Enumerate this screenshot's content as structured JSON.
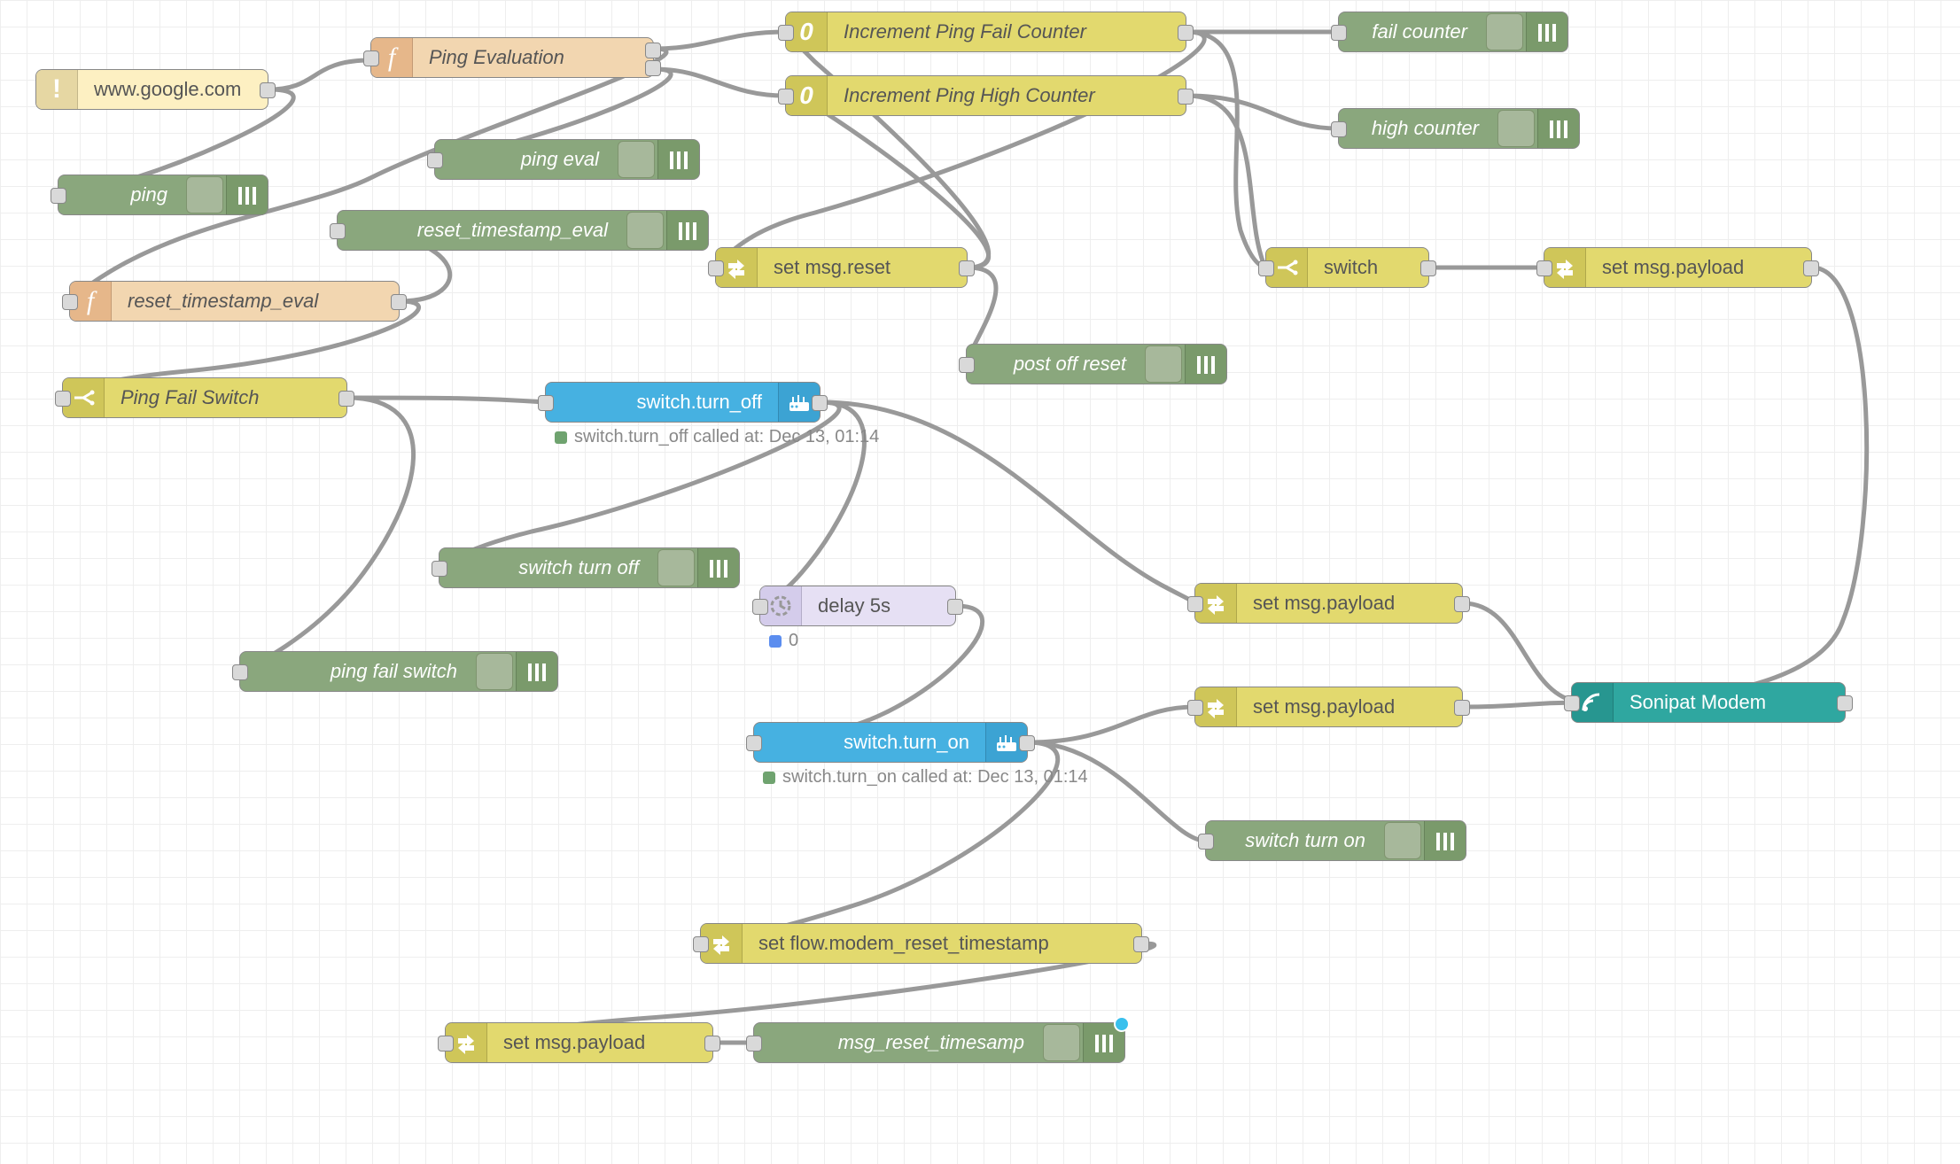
{
  "nodes": {
    "www_google": {
      "label": "www.google.com"
    },
    "ping_eval_fn": {
      "label": "Ping Evaluation"
    },
    "inc_fail": {
      "label": "Increment Ping Fail Counter"
    },
    "inc_high": {
      "label": "Increment Ping High Counter"
    },
    "fail_counter": {
      "label": "fail counter"
    },
    "high_counter": {
      "label": "high counter"
    },
    "ping_debug": {
      "label": "ping"
    },
    "ping_eval_debug": {
      "label": "ping eval"
    },
    "reset_ts_debug": {
      "label": "reset_timestamp_eval"
    },
    "reset_ts_fn": {
      "label": "reset_timestamp_eval"
    },
    "set_reset": {
      "label": "set msg.reset"
    },
    "post_off_reset": {
      "label": "post off reset"
    },
    "switch_gen": {
      "label": "switch"
    },
    "set_payload_1": {
      "label": "set msg.payload"
    },
    "ping_fail_sw": {
      "label": "Ping Fail Switch"
    },
    "switch_off": {
      "label": "switch.turn_off"
    },
    "switch_off_dbg": {
      "label": "switch turn off"
    },
    "ping_fail_dbg": {
      "label": "ping fail switch"
    },
    "delay5": {
      "label": "delay 5s"
    },
    "set_payload_2": {
      "label": "set msg.payload"
    },
    "set_payload_3": {
      "label": "set msg.payload"
    },
    "switch_on": {
      "label": "switch.turn_on"
    },
    "switch_on_dbg": {
      "label": "switch turn on"
    },
    "sonipat": {
      "label": "Sonipat Modem"
    },
    "set_flow_ts": {
      "label": "set flow.modem_reset_timestamp"
    },
    "set_payload_4": {
      "label": "set msg.payload"
    },
    "msg_reset_ts": {
      "label": "msg_reset_timesamp"
    }
  },
  "status": {
    "switch_off": "switch.turn_off called at: Dec 13, 01:14",
    "delay5": "0",
    "switch_on": "switch.turn_on called at: Dec 13, 01:14"
  },
  "icons": {
    "exclaim": "!",
    "func": "f",
    "counter": "0"
  },
  "colors": {
    "cream": "#fdf0c2",
    "orange": "#f2d6b0",
    "yellow": "#e2d96e",
    "green": "#8aa77d",
    "blue": "#46b1e1",
    "teal": "#2fa7a0",
    "lilac": "#e6e0f4",
    "wire": "#999999"
  }
}
